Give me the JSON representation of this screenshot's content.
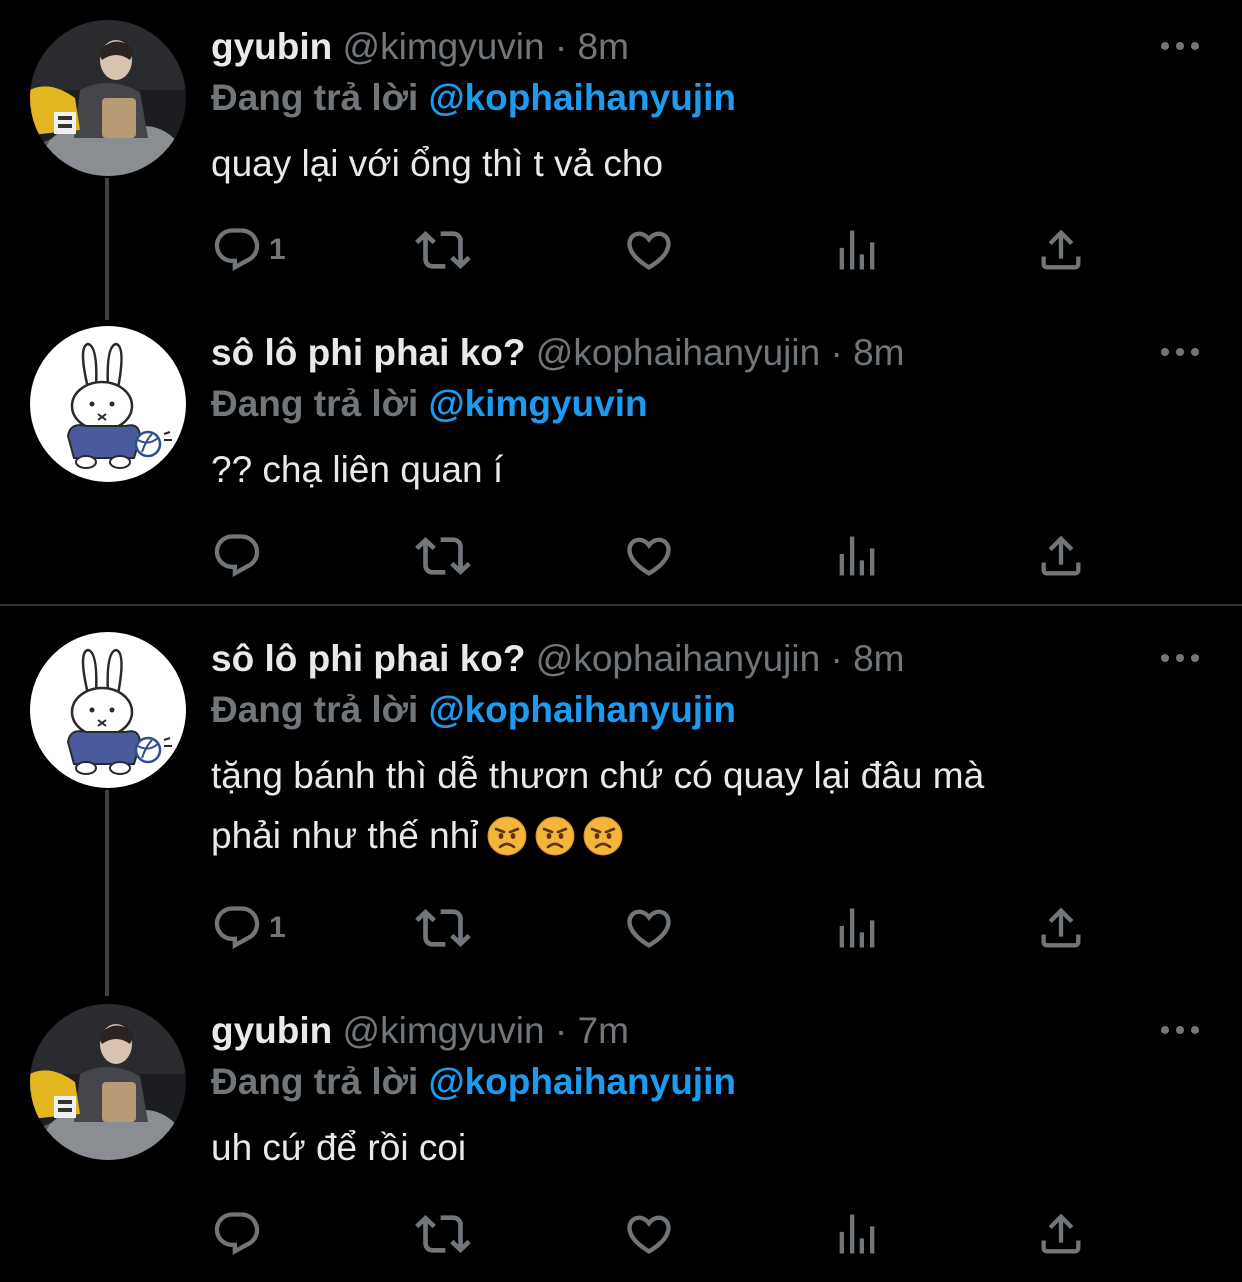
{
  "colors": {
    "background": "#000000",
    "text": "#e7e9ea",
    "muted": "#71767b",
    "link": "#1d9bf0",
    "thread_line": "#3e4144",
    "divider": "#2f3336"
  },
  "tweets": [
    {
      "display_name": "gyubin",
      "handle": "@kimgyuvin",
      "separator": "·",
      "time": "8m",
      "reply_prefix": "Đang trả lời",
      "reply_to": "@kophaihanyujin",
      "text": "quay lại với ổng thì t vả cho",
      "reply_count": "1",
      "avatar_icon": "person-photo-avatar"
    },
    {
      "display_name": "sô lô phi phai ko?",
      "handle": "@kophaihanyujin",
      "separator": "·",
      "time": "8m",
      "reply_prefix": "Đang trả lời",
      "reply_to": "@kimgyuvin",
      "text": "?? chạ liên quan í",
      "reply_count": "",
      "avatar_icon": "bunny-avatar"
    },
    {
      "display_name": "sô lô phi phai ko?",
      "handle": "@kophaihanyujin",
      "separator": "·",
      "time": "8m",
      "reply_prefix": "Đang trả lời",
      "reply_to": "@kophaihanyujin",
      "text_line1": "tặng bánh thì dễ thươn chứ có quay lại đâu mà",
      "text_line2": "phải như thế nhỉ",
      "emojis": [
        "angry-face",
        "angry-face",
        "angry-face"
      ],
      "reply_count": "1",
      "avatar_icon": "bunny-avatar"
    },
    {
      "display_name": "gyubin",
      "handle": "@kimgyuvin",
      "separator": "·",
      "time": "7m",
      "reply_prefix": "Đang trả lời",
      "reply_to": "@kophaihanyujin",
      "text": "uh cứ để rồi coi",
      "reply_count": "",
      "avatar_icon": "person-photo-avatar"
    }
  ]
}
